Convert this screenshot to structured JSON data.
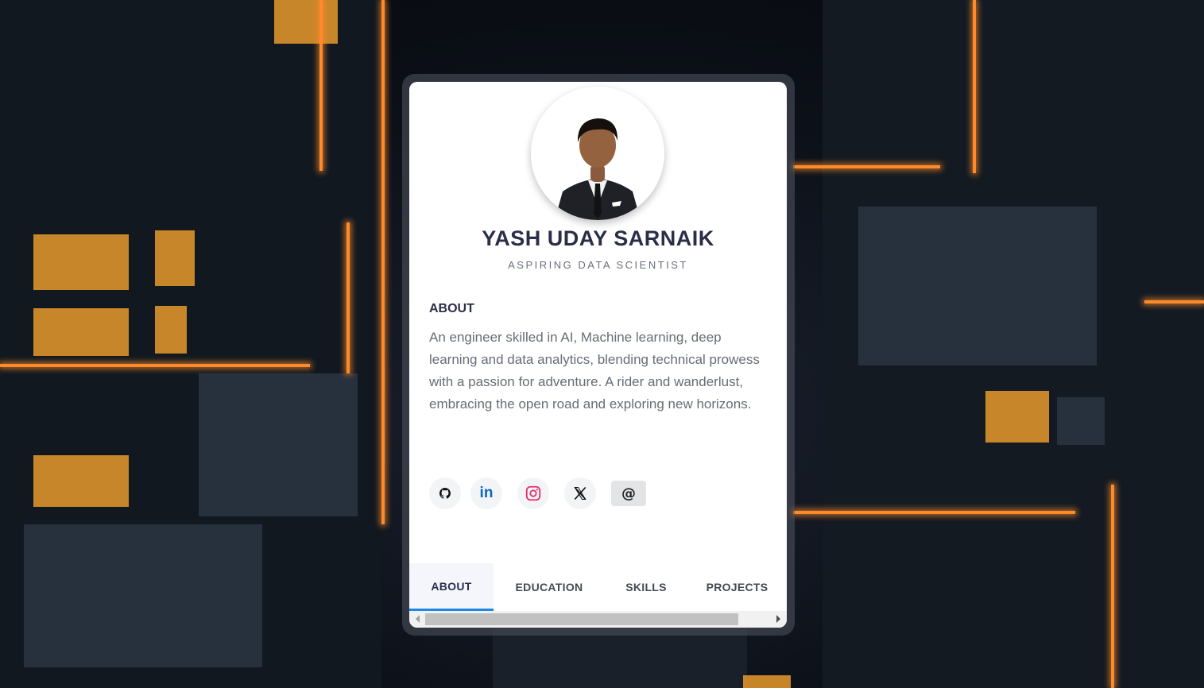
{
  "profile": {
    "name": "YASH UDAY SARNAIK",
    "role": "ASPIRING DATA SCIENTIST"
  },
  "about": {
    "title": "ABOUT",
    "text": "An engineer skilled in AI, Machine learning, deep learning and data analytics, blending technical prowess with a passion for adventure. A rider and wanderlust, embracing the open road and exploring new horizons."
  },
  "socials": [
    {
      "name": "github",
      "icon": "github-icon"
    },
    {
      "name": "linkedin",
      "icon": "linkedin-icon",
      "color": "#0a66c2",
      "label": "in"
    },
    {
      "name": "instagram",
      "icon": "instagram-icon",
      "color": "#e1306c"
    },
    {
      "name": "x",
      "icon": "x-icon",
      "label": "𝕏"
    },
    {
      "name": "mail",
      "icon": "at-sign-icon",
      "label": "@"
    }
  ],
  "tabs": [
    {
      "label": "ABOUT",
      "active": true
    },
    {
      "label": "EDUCATION",
      "active": false
    },
    {
      "label": "SKILLS",
      "active": false
    },
    {
      "label": "PROJECTS",
      "active": false
    }
  ],
  "colors": {
    "accent": "#1e88e5",
    "name": "#2b2e48",
    "neon": "#ff8a2a"
  }
}
